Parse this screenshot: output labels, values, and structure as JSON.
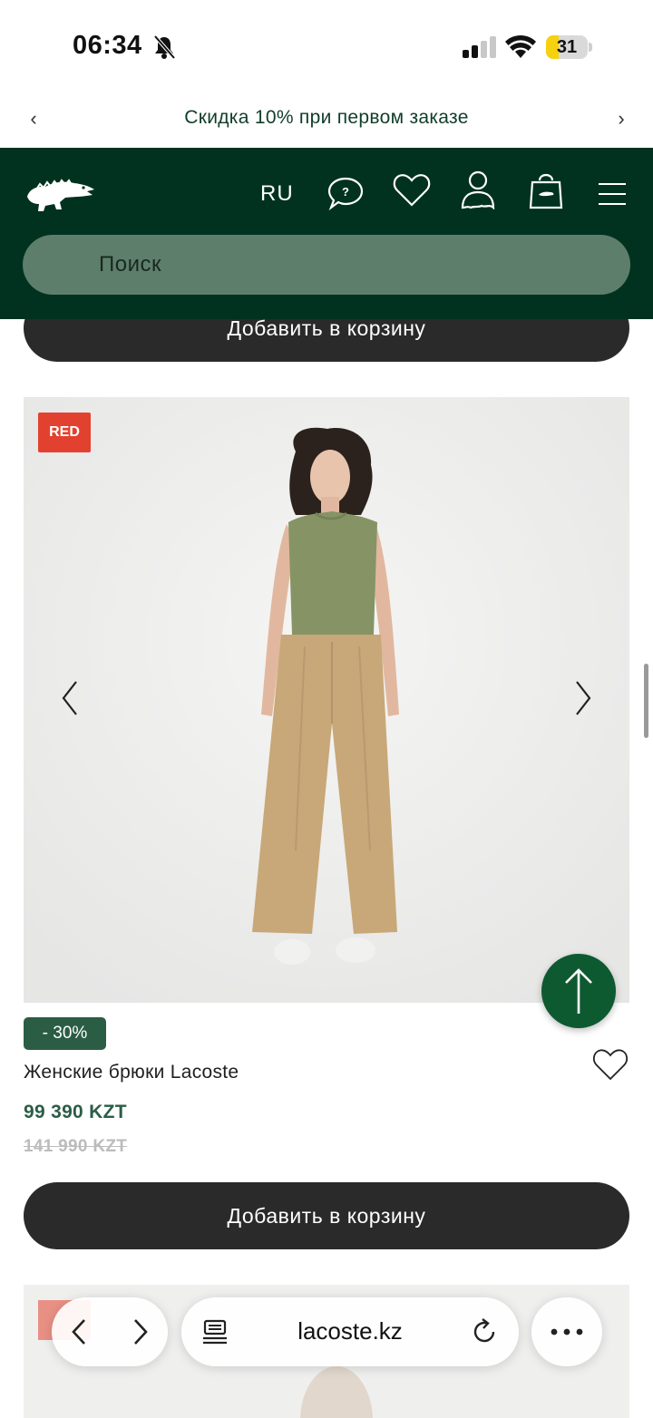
{
  "status_bar": {
    "time": "06:34",
    "battery_level": "31",
    "battery_fraction": 0.31
  },
  "promo": {
    "text": "Скидка 10% при первом заказе",
    "prev_glyph": "‹",
    "next_glyph": "›"
  },
  "header": {
    "language": "RU",
    "search_placeholder": "Поиск",
    "background_color": "#013220",
    "icons": [
      "lacoste-crocodile-logo",
      "help-chat-icon",
      "wishlist-heart-icon",
      "account-icon",
      "shopping-bag-icon",
      "menu-icon"
    ]
  },
  "previous_product": {
    "add_to_cart_label": "Добавить в корзину"
  },
  "product": {
    "badge": "RED",
    "discount": "- 30%",
    "title": "Женские брюки Lacoste",
    "price": "99 390 KZT",
    "old_price": "141 990 KZT",
    "add_to_cart_label": "Добавить в корзину",
    "accent_color": "#2b5d45",
    "badge_color": "#e3412f"
  },
  "browser": {
    "url": "lacoste.kz"
  }
}
